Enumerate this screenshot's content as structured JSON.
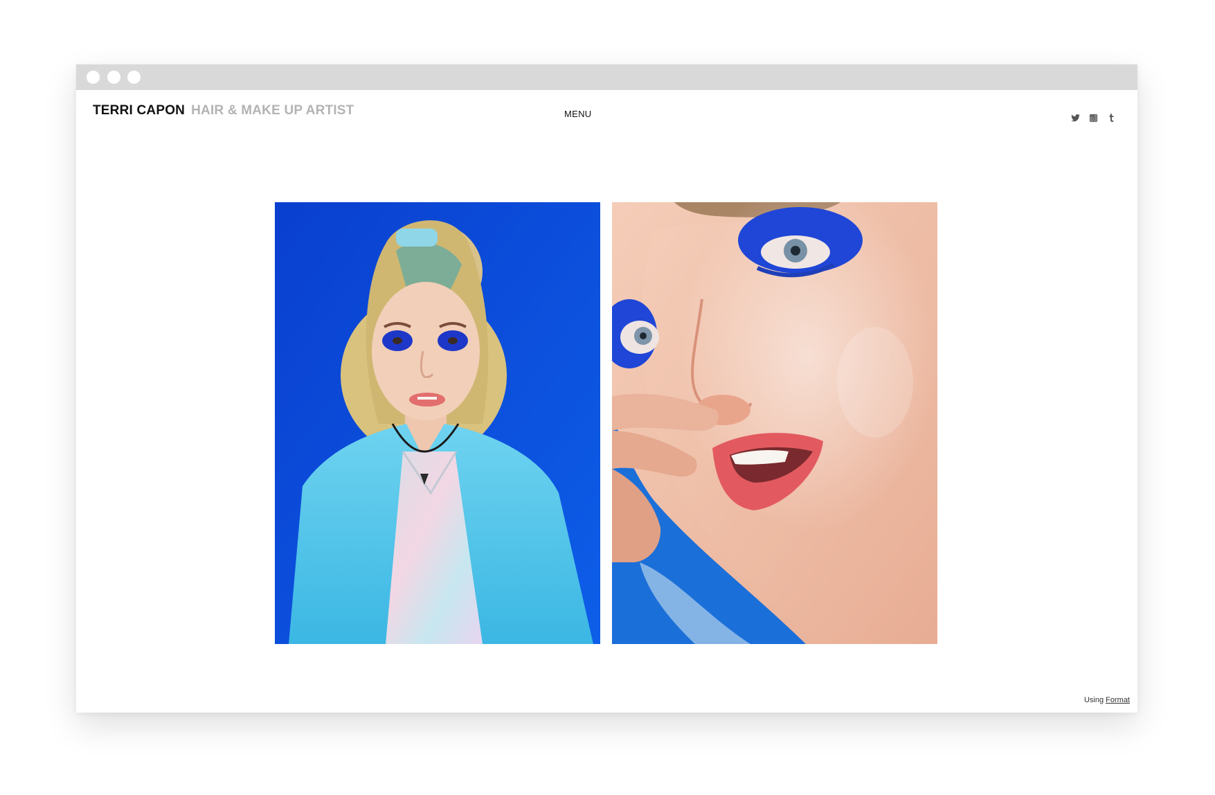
{
  "header": {
    "brand_name": "TERRI CAPON",
    "brand_tagline": "HAIR & MAKE UP ARTIST",
    "menu_label": "MENU"
  },
  "social": {
    "icons": [
      "twitter-icon",
      "instagram-icon",
      "tumblr-icon"
    ]
  },
  "gallery": {
    "images": [
      {
        "name": "portrait-blue-background"
      },
      {
        "name": "closeup-blue-eyeshadow"
      }
    ]
  },
  "footer": {
    "prefix": "Using",
    "link_label": "Format"
  },
  "colors": {
    "brand_name": "#111111",
    "brand_tagline": "#b3b3b3",
    "titlebar": "#d9d9d9",
    "photo_blue": "#0a4fd6"
  }
}
